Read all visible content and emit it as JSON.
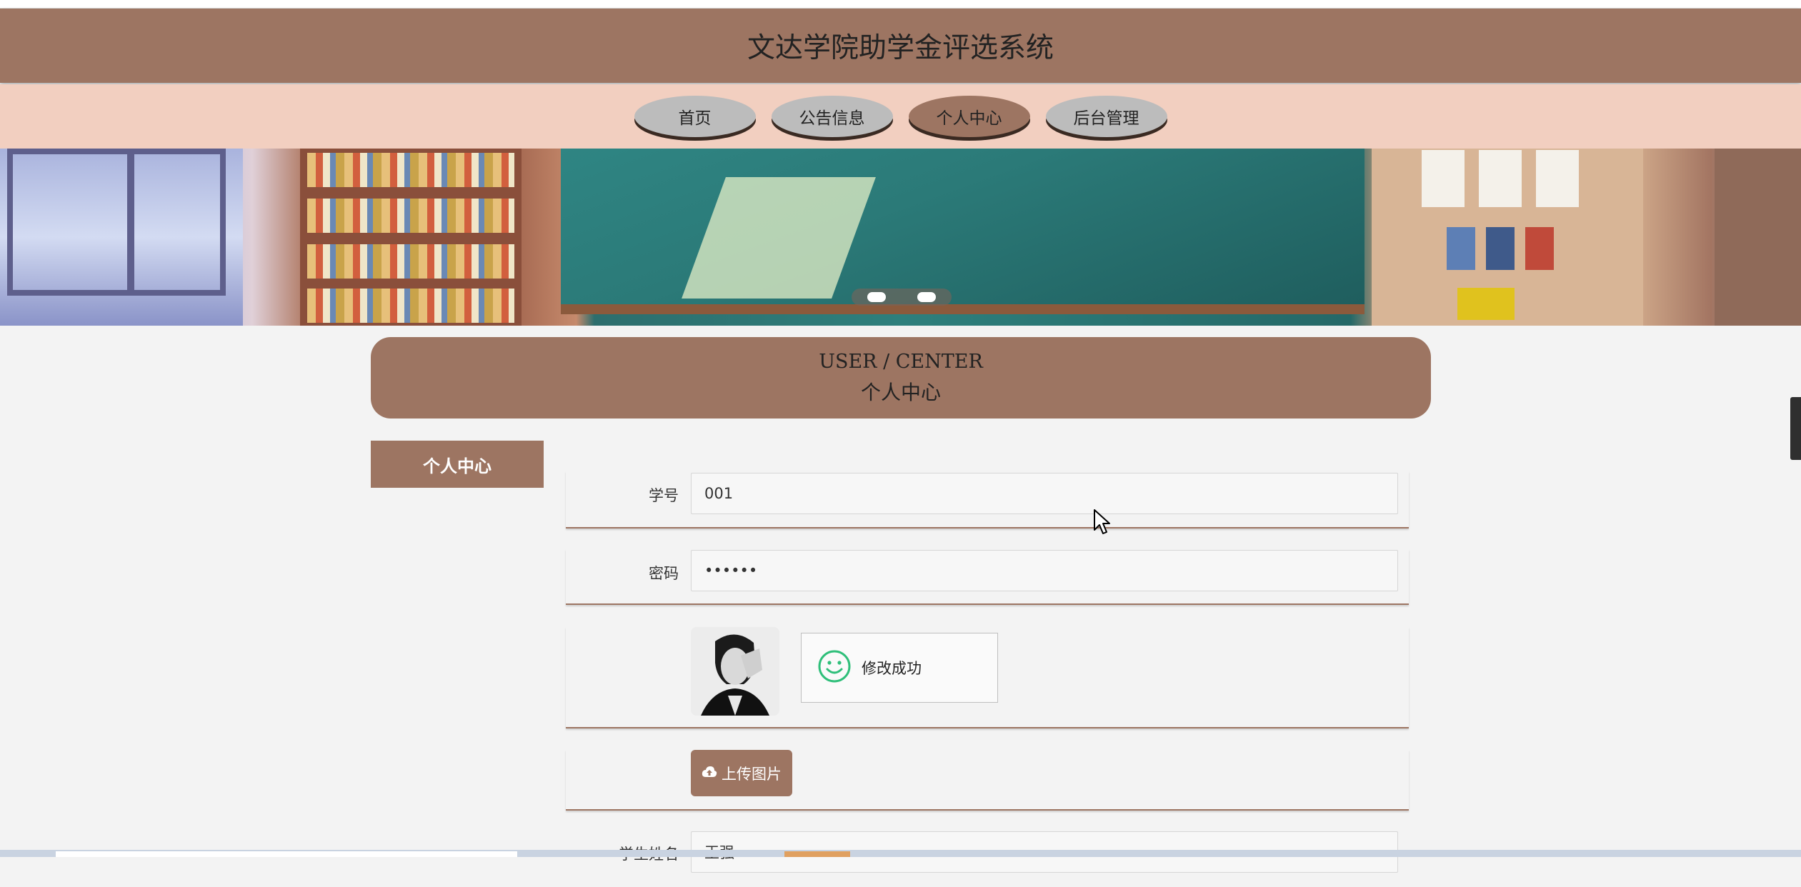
{
  "header": {
    "title": "文达学院助学金评选系统"
  },
  "nav": {
    "items": [
      {
        "label": "首页",
        "active": false
      },
      {
        "label": "公告信息",
        "active": false
      },
      {
        "label": "个人中心",
        "active": true
      },
      {
        "label": "后台管理",
        "active": false
      }
    ]
  },
  "section": {
    "title_en": "USER / CENTER",
    "title_cn": "个人中心"
  },
  "sidebar": {
    "tab_label": "个人中心"
  },
  "form": {
    "student_id": {
      "label": "学号",
      "value": "001"
    },
    "password": {
      "label": "密码",
      "value": "••••••"
    },
    "toast": {
      "message": "修改成功",
      "icon": "smile-icon"
    },
    "upload": {
      "label": "上传图片",
      "icon": "cloud-upload-icon"
    },
    "student_name": {
      "label": "学生姓名",
      "value": "王强"
    }
  },
  "colors": {
    "accent": "#9d7562",
    "nav_bg": "#f2cfc0",
    "page_bg": "#f3f3f3"
  }
}
